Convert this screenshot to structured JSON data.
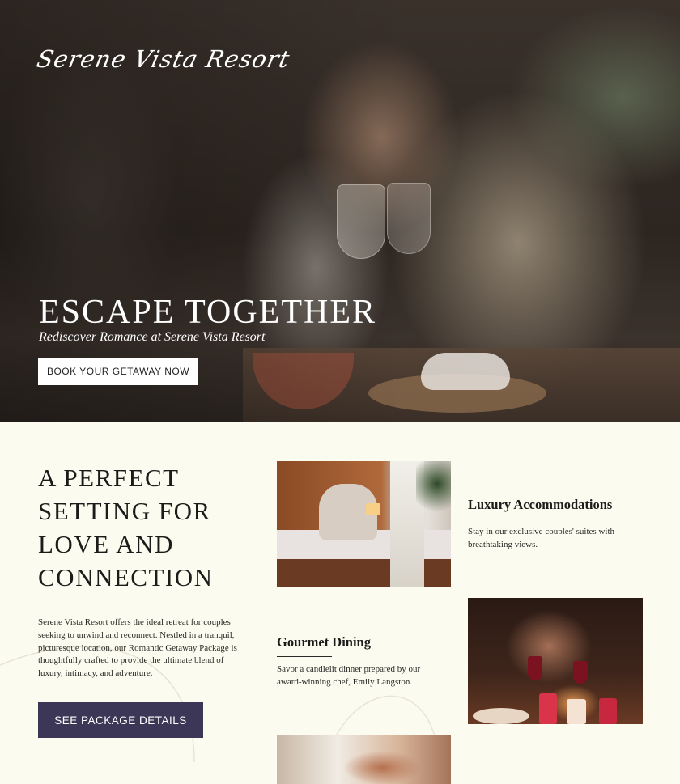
{
  "brand": {
    "logo_text": "Serene Vista Resort"
  },
  "hero": {
    "title": "ESCAPE TOGETHER",
    "subtitle": "Rediscover Romance at Serene Vista Resort",
    "cta_label": "BOOK YOUR GETAWAY NOW"
  },
  "intro": {
    "title_lines": [
      "A PERFECT",
      "SETTING FOR",
      "LOVE AND",
      "CONNECTION"
    ],
    "body": "Serene Vista Resort offers the ideal retreat for couples seeking to unwind and reconnect. Nestled in a tranquil, picturesque location, our Romantic Getaway Package is thoughtfully crafted to provide the ultimate blend of luxury, intimacy, and adventure.",
    "cta_label": "SEE PACKAGE DETAILS"
  },
  "features": [
    {
      "title": "Luxury Accommodations",
      "description": "Stay in our exclusive couples' suites with breathtaking views."
    },
    {
      "title": "Gourmet Dining",
      "description": "Savor a candlelit dinner prepared by our award-winning chef, Emily Langston."
    }
  ],
  "colors": {
    "background": "#fcfbef",
    "accent": "#3d3757",
    "text": "#1c1b1a"
  }
}
